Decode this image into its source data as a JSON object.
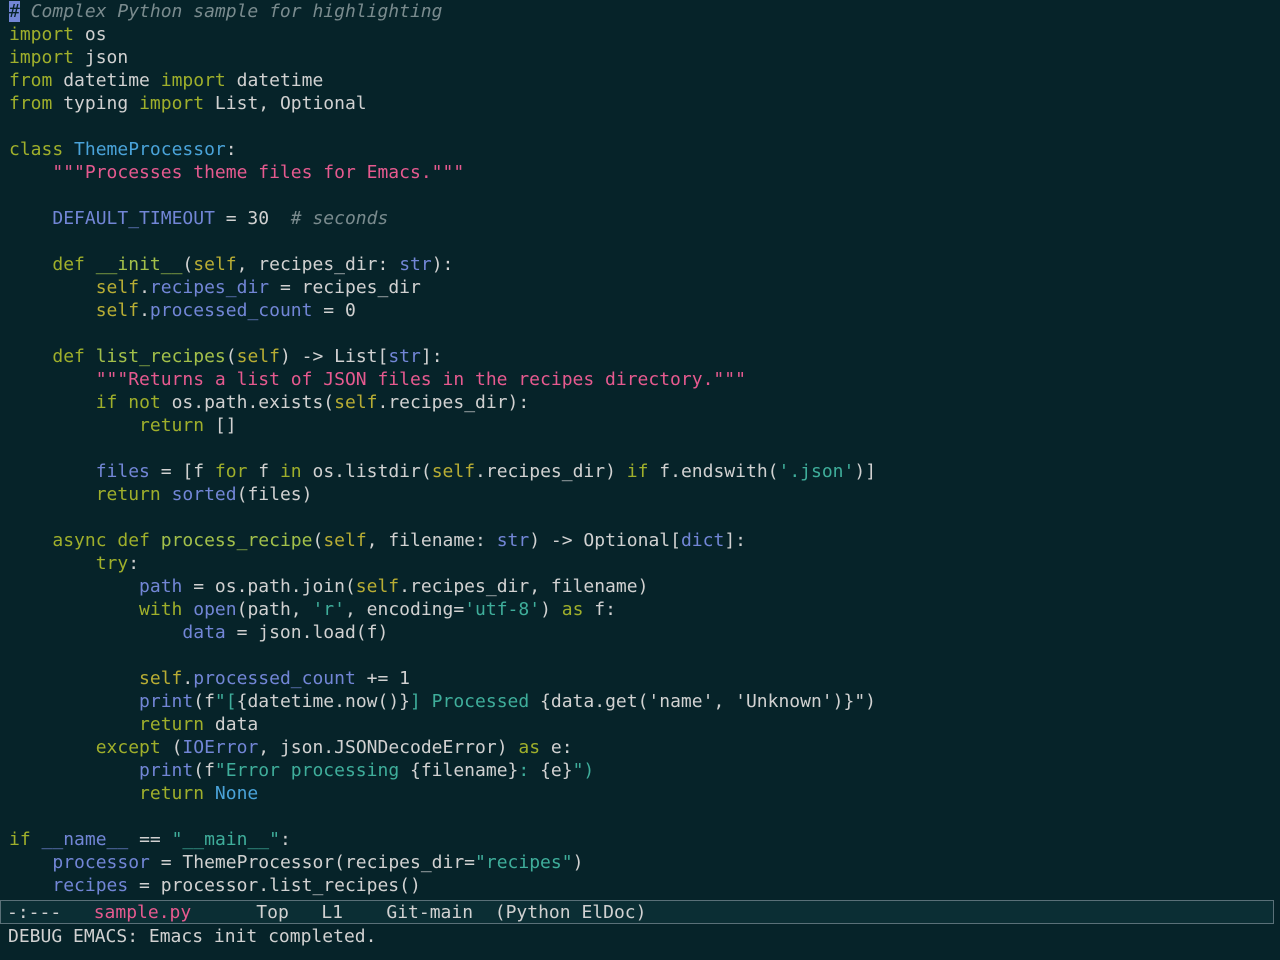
{
  "editor": {
    "lines": [
      [
        {
          "t": "#",
          "c": "cursor"
        },
        {
          "t": " Complex Python sample for highlighting",
          "c": "comment"
        }
      ],
      [
        {
          "t": "import",
          "c": "keyword"
        },
        {
          "t": " os",
          "c": "plain"
        }
      ],
      [
        {
          "t": "import",
          "c": "keyword"
        },
        {
          "t": " json",
          "c": "plain"
        }
      ],
      [
        {
          "t": "from",
          "c": "keyword"
        },
        {
          "t": " datetime ",
          "c": "plain"
        },
        {
          "t": "import",
          "c": "keyword"
        },
        {
          "t": " datetime",
          "c": "plain"
        }
      ],
      [
        {
          "t": "from",
          "c": "keyword"
        },
        {
          "t": " typing ",
          "c": "plain"
        },
        {
          "t": "import",
          "c": "keyword"
        },
        {
          "t": " List, Optional",
          "c": "plain"
        }
      ],
      [],
      [
        {
          "t": "class",
          "c": "keyword"
        },
        {
          "t": " ",
          "c": "plain"
        },
        {
          "t": "ThemeProcessor",
          "c": "class"
        },
        {
          "t": ":",
          "c": "plain"
        }
      ],
      [
        {
          "t": "    ",
          "c": "plain"
        },
        {
          "t": "\"\"\"Processes theme files for Emacs.\"\"\"",
          "c": "string"
        }
      ],
      [],
      [
        {
          "t": "    ",
          "c": "plain"
        },
        {
          "t": "DEFAULT_TIMEOUT",
          "c": "attr"
        },
        {
          "t": " = 30  ",
          "c": "plain"
        },
        {
          "t": "# seconds",
          "c": "comment"
        }
      ],
      [],
      [
        {
          "t": "    ",
          "c": "plain"
        },
        {
          "t": "def",
          "c": "keyword"
        },
        {
          "t": " ",
          "c": "plain"
        },
        {
          "t": "__init__",
          "c": "function"
        },
        {
          "t": "(",
          "c": "plain"
        },
        {
          "t": "self",
          "c": "self"
        },
        {
          "t": ", recipes_dir: ",
          "c": "plain"
        },
        {
          "t": "str",
          "c": "builtin"
        },
        {
          "t": "):",
          "c": "plain"
        }
      ],
      [
        {
          "t": "        ",
          "c": "plain"
        },
        {
          "t": "self",
          "c": "self"
        },
        {
          "t": ".",
          "c": "plain"
        },
        {
          "t": "recipes_dir",
          "c": "attr"
        },
        {
          "t": " = recipes_dir",
          "c": "plain"
        }
      ],
      [
        {
          "t": "        ",
          "c": "plain"
        },
        {
          "t": "self",
          "c": "self"
        },
        {
          "t": ".",
          "c": "plain"
        },
        {
          "t": "processed_count",
          "c": "attr"
        },
        {
          "t": " = 0",
          "c": "plain"
        }
      ],
      [],
      [
        {
          "t": "    ",
          "c": "plain"
        },
        {
          "t": "def",
          "c": "keyword"
        },
        {
          "t": " ",
          "c": "plain"
        },
        {
          "t": "list_recipes",
          "c": "function"
        },
        {
          "t": "(",
          "c": "plain"
        },
        {
          "t": "self",
          "c": "self"
        },
        {
          "t": ") -> List[",
          "c": "plain"
        },
        {
          "t": "str",
          "c": "builtin"
        },
        {
          "t": "]:",
          "c": "plain"
        }
      ],
      [
        {
          "t": "        ",
          "c": "plain"
        },
        {
          "t": "\"\"\"Returns a list of JSON files in the recipes directory.\"\"\"",
          "c": "string"
        }
      ],
      [
        {
          "t": "        ",
          "c": "plain"
        },
        {
          "t": "if",
          "c": "keyword"
        },
        {
          "t": " ",
          "c": "plain"
        },
        {
          "t": "not",
          "c": "keyword"
        },
        {
          "t": " os.path.exists(",
          "c": "plain"
        },
        {
          "t": "self",
          "c": "self"
        },
        {
          "t": ".recipes_dir):",
          "c": "plain"
        }
      ],
      [
        {
          "t": "            ",
          "c": "plain"
        },
        {
          "t": "return",
          "c": "keyword"
        },
        {
          "t": " []",
          "c": "plain"
        }
      ],
      [],
      [
        {
          "t": "        ",
          "c": "plain"
        },
        {
          "t": "files",
          "c": "attr"
        },
        {
          "t": " = [f ",
          "c": "plain"
        },
        {
          "t": "for",
          "c": "keyword"
        },
        {
          "t": " f ",
          "c": "plain"
        },
        {
          "t": "in",
          "c": "keyword"
        },
        {
          "t": " os.listdir(",
          "c": "plain"
        },
        {
          "t": "self",
          "c": "self"
        },
        {
          "t": ".recipes_dir) ",
          "c": "plain"
        },
        {
          "t": "if",
          "c": "keyword"
        },
        {
          "t": " f.endswith(",
          "c": "plain"
        },
        {
          "t": "'.json'",
          "c": "string2"
        },
        {
          "t": ")]",
          "c": "plain"
        }
      ],
      [
        {
          "t": "        ",
          "c": "plain"
        },
        {
          "t": "return",
          "c": "keyword"
        },
        {
          "t": " ",
          "c": "plain"
        },
        {
          "t": "sorted",
          "c": "builtin"
        },
        {
          "t": "(files)",
          "c": "plain"
        }
      ],
      [],
      [
        {
          "t": "    ",
          "c": "plain"
        },
        {
          "t": "async",
          "c": "keyword"
        },
        {
          "t": " ",
          "c": "plain"
        },
        {
          "t": "def",
          "c": "keyword"
        },
        {
          "t": " ",
          "c": "plain"
        },
        {
          "t": "process_recipe",
          "c": "function"
        },
        {
          "t": "(",
          "c": "plain"
        },
        {
          "t": "self",
          "c": "self"
        },
        {
          "t": ", filename: ",
          "c": "plain"
        },
        {
          "t": "str",
          "c": "builtin"
        },
        {
          "t": ") -> Optional[",
          "c": "plain"
        },
        {
          "t": "dict",
          "c": "builtin"
        },
        {
          "t": "]:",
          "c": "plain"
        }
      ],
      [
        {
          "t": "        ",
          "c": "plain"
        },
        {
          "t": "try",
          "c": "keyword"
        },
        {
          "t": ":",
          "c": "plain"
        }
      ],
      [
        {
          "t": "            ",
          "c": "plain"
        },
        {
          "t": "path",
          "c": "attr"
        },
        {
          "t": " = os.path.join(",
          "c": "plain"
        },
        {
          "t": "self",
          "c": "self"
        },
        {
          "t": ".recipes_dir, filename)",
          "c": "plain"
        }
      ],
      [
        {
          "t": "            ",
          "c": "plain"
        },
        {
          "t": "with",
          "c": "keyword"
        },
        {
          "t": " ",
          "c": "plain"
        },
        {
          "t": "open",
          "c": "builtin"
        },
        {
          "t": "(path, ",
          "c": "plain"
        },
        {
          "t": "'r'",
          "c": "string2"
        },
        {
          "t": ", encoding=",
          "c": "plain"
        },
        {
          "t": "'utf-8'",
          "c": "string2"
        },
        {
          "t": ") ",
          "c": "plain"
        },
        {
          "t": "as",
          "c": "keyword"
        },
        {
          "t": " f:",
          "c": "plain"
        }
      ],
      [
        {
          "t": "                ",
          "c": "plain"
        },
        {
          "t": "data",
          "c": "attr"
        },
        {
          "t": " = json.load(f)",
          "c": "plain"
        }
      ],
      [],
      [
        {
          "t": "            ",
          "c": "plain"
        },
        {
          "t": "self",
          "c": "self"
        },
        {
          "t": ".",
          "c": "plain"
        },
        {
          "t": "processed_count",
          "c": "attr"
        },
        {
          "t": " += 1",
          "c": "plain"
        }
      ],
      [
        {
          "t": "            ",
          "c": "plain"
        },
        {
          "t": "print",
          "c": "builtin"
        },
        {
          "t": "(f",
          "c": "plain"
        },
        {
          "t": "\"[",
          "c": "string2"
        },
        {
          "t": "{datetime.now()}",
          "c": "plain"
        },
        {
          "t": "] Processed ",
          "c": "string2"
        },
        {
          "t": "{data.get('name', 'Unknown')}",
          "c": "plain"
        },
        {
          "t": "\")",
          "c": "plain"
        }
      ],
      [
        {
          "t": "            ",
          "c": "plain"
        },
        {
          "t": "return",
          "c": "keyword"
        },
        {
          "t": " data",
          "c": "plain"
        }
      ],
      [
        {
          "t": "        ",
          "c": "plain"
        },
        {
          "t": "except",
          "c": "keyword"
        },
        {
          "t": " (",
          "c": "plain"
        },
        {
          "t": "IOError",
          "c": "builtin"
        },
        {
          "t": ", json.JSONDecodeError) ",
          "c": "plain"
        },
        {
          "t": "as",
          "c": "keyword"
        },
        {
          "t": " e:",
          "c": "plain"
        }
      ],
      [
        {
          "t": "            ",
          "c": "plain"
        },
        {
          "t": "print",
          "c": "builtin"
        },
        {
          "t": "(f",
          "c": "plain"
        },
        {
          "t": "\"Error processing ",
          "c": "string2"
        },
        {
          "t": "{filename}",
          "c": "plain"
        },
        {
          "t": ": ",
          "c": "string2"
        },
        {
          "t": "{e}",
          "c": "plain"
        },
        {
          "t": "\")",
          "c": "string2"
        }
      ],
      [
        {
          "t": "            ",
          "c": "plain"
        },
        {
          "t": "return",
          "c": "keyword"
        },
        {
          "t": " ",
          "c": "plain"
        },
        {
          "t": "None",
          "c": "const"
        }
      ],
      [],
      [
        {
          "t": "if",
          "c": "keyword"
        },
        {
          "t": " ",
          "c": "plain"
        },
        {
          "t": "__name__",
          "c": "attr"
        },
        {
          "t": " == ",
          "c": "plain"
        },
        {
          "t": "\"__main__\"",
          "c": "string2"
        },
        {
          "t": ":",
          "c": "plain"
        }
      ],
      [
        {
          "t": "    ",
          "c": "plain"
        },
        {
          "t": "processor",
          "c": "attr"
        },
        {
          "t": " = ThemeProcessor(recipes_dir=",
          "c": "plain"
        },
        {
          "t": "\"recipes\"",
          "c": "string2"
        },
        {
          "t": ")",
          "c": "plain"
        }
      ],
      [
        {
          "t": "    ",
          "c": "plain"
        },
        {
          "t": "recipes",
          "c": "attr"
        },
        {
          "t": " = processor.list_recipes()",
          "c": "plain"
        }
      ]
    ]
  },
  "mode_line": {
    "status": "-:---",
    "buffer_name": "sample.py",
    "position": "Top",
    "line": "L1",
    "vc": "Git-main",
    "modes": "(Python ElDoc)"
  },
  "echo_area": {
    "message": "DEBUG EMACS: Emacs init completed."
  },
  "colors": {
    "background": "#062329",
    "comment": "#7a8b8e",
    "keyword": "#9faf2b",
    "class": "#4aa3d9",
    "function": "#a3c04a",
    "builtin": "#7286d6",
    "string": "#e65a8f",
    "string_alt": "#3fae9b",
    "self": "#b8ad34",
    "default_text": "#d1d1d1"
  }
}
